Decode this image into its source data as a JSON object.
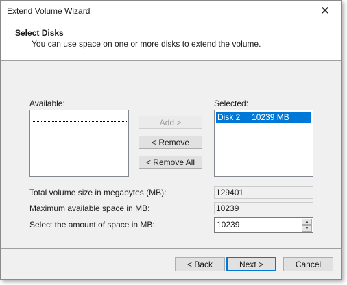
{
  "window": {
    "title": "Extend Volume Wizard",
    "close_glyph": "✕"
  },
  "header": {
    "title": "Select Disks",
    "subtitle": "You can use space on one or more disks to extend the volume."
  },
  "available": {
    "label": "Available:",
    "items": []
  },
  "selected": {
    "label": "Selected:",
    "items": [
      {
        "disk": "Disk 2",
        "size": "10239 MB"
      }
    ]
  },
  "buttons": {
    "add": "Add >",
    "remove": "< Remove",
    "remove_all": "< Remove All",
    "back": "< Back",
    "next": "Next >",
    "cancel": "Cancel"
  },
  "fields": {
    "total_label": "Total volume size in megabytes (MB):",
    "total_value": "129401",
    "max_label": "Maximum available space in MB:",
    "max_value": "10239",
    "amount_label": "Select the amount of space in MB:",
    "amount_value": "10239"
  },
  "colors": {
    "selection": "#0078d7",
    "dialog_bg": "#f0f0f0"
  }
}
